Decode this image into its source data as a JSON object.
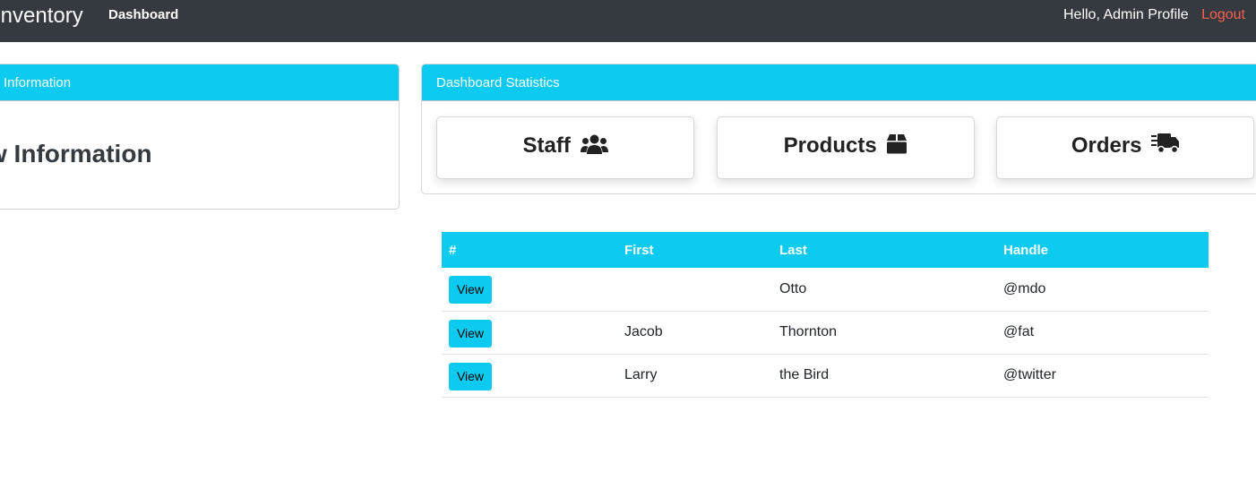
{
  "nav": {
    "brand": "Inventory",
    "dashboard_link": "Dashboard",
    "greeting": "Hello,",
    "profile": "Admin Profile",
    "logout": "Logout"
  },
  "info_card": {
    "header": "Information",
    "title": "w Information"
  },
  "stats_card": {
    "header": "Dashboard Statistics",
    "items": [
      {
        "label": "Staff",
        "icon": "users-icon"
      },
      {
        "label": "Products",
        "icon": "box-icon"
      },
      {
        "label": "Orders",
        "icon": "truck-icon"
      }
    ]
  },
  "table": {
    "headers": [
      "#",
      "First",
      "Last",
      "Handle"
    ],
    "button_label": "View",
    "rows": [
      {
        "first": "",
        "last": "Otto",
        "handle": "@mdo"
      },
      {
        "first": "Jacob",
        "last": "Thornton",
        "handle": "@fat"
      },
      {
        "first": "Larry",
        "last": "the Bird",
        "handle": "@twitter"
      }
    ]
  },
  "colors": {
    "navbar": "#343a40",
    "accent": "#0dcaf0",
    "logout": "#ff5f4f"
  }
}
